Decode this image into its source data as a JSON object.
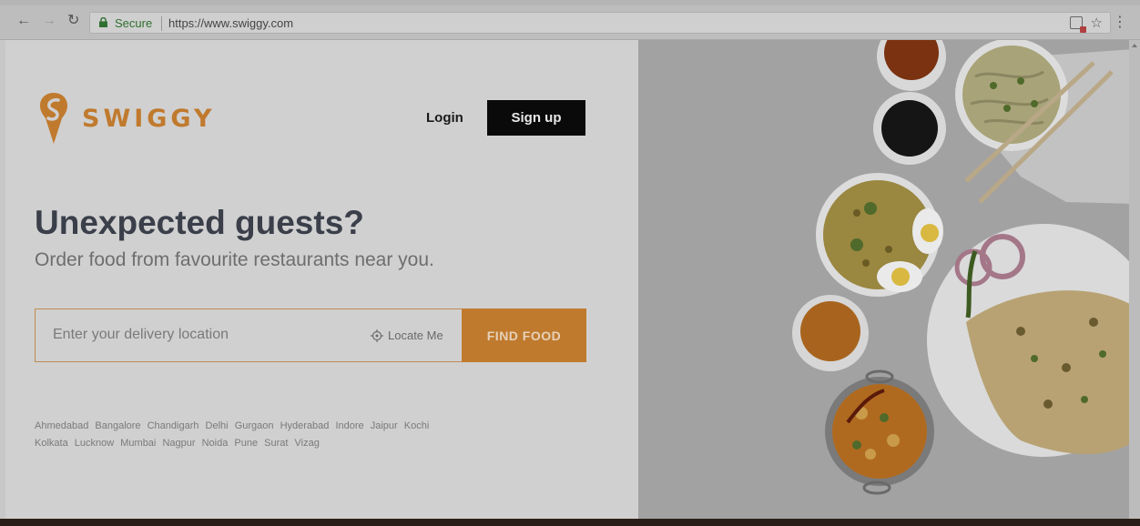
{
  "browser": {
    "secure_label": "Secure",
    "url": "https://www.swiggy.com"
  },
  "header": {
    "logo_text": "SWIGGY",
    "login_label": "Login",
    "signup_label": "Sign up"
  },
  "hero": {
    "headline": "Unexpected guests?",
    "subline": "Order food from favourite restaurants near you."
  },
  "search": {
    "placeholder": "Enter your delivery location",
    "locate_label": "Locate Me",
    "button_label": "FIND FOOD"
  },
  "cities": [
    "Ahmedabad",
    "Bangalore",
    "Chandigarh",
    "Delhi",
    "Gurgaon",
    "Hyderabad",
    "Indore",
    "Jaipur",
    "Kochi",
    "Kolkata",
    "Lucknow",
    "Mumbai",
    "Nagpur",
    "Noida",
    "Pune",
    "Surat",
    "Vizag"
  ],
  "colors": {
    "brand_orange": "#c07a2e",
    "signup_bg": "#0a0a0a"
  }
}
